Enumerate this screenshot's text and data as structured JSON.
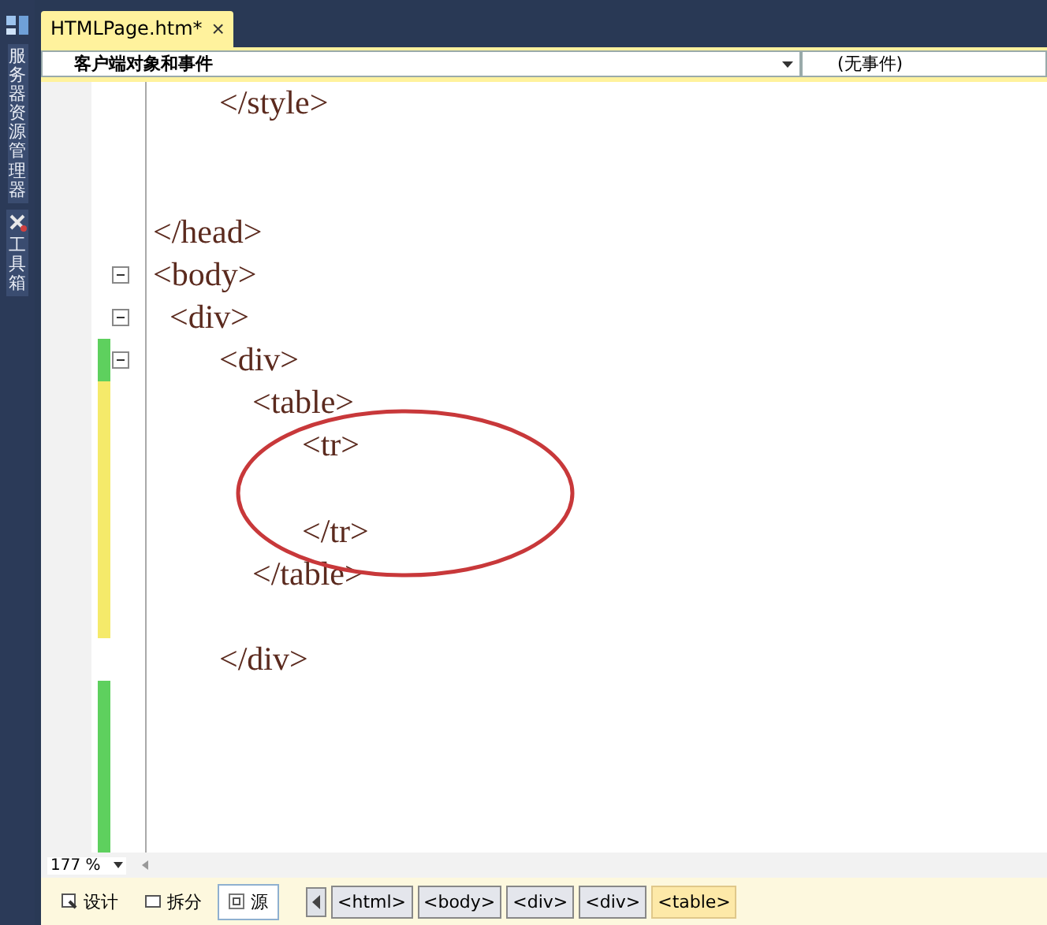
{
  "side_panel": {
    "tabs": [
      {
        "label": "服务器资源管理器"
      },
      {
        "label": "工具箱"
      }
    ]
  },
  "document_tab": {
    "title": "HTMLPage.htm*",
    "close": "×"
  },
  "navigation_bar": {
    "objects": "客户端对象和事件",
    "events": "(无事件)"
  },
  "editor": {
    "lines": [
      {
        "text": "        </style>"
      },
      {
        "kind": "blank"
      },
      {
        "kind": "blank"
      },
      {
        "text": "</head>"
      },
      {
        "text": "<body>",
        "fold": true
      },
      {
        "text": "  <div>",
        "fold": true
      },
      {
        "text": "        <div>",
        "fold": true,
        "color": "#5ed05e"
      },
      {
        "text": "            <table>",
        "color": "#f5ea6a"
      },
      {
        "text": "                  <tr>",
        "color": "#f5ea6a"
      },
      {
        "color": "#f5ea6a"
      },
      {
        "text": "                  </tr>",
        "color": "#f5ea6a"
      },
      {
        "text": "            </table>",
        "color": "#f5ea6a"
      },
      {
        "color": "#f5ea6a"
      },
      {
        "text": "        </div>"
      },
      {
        "color": "#5ed05e"
      },
      {
        "color": "#5ed05e"
      },
      {
        "color": "#5ed05e"
      },
      {
        "color": "#5ed05e"
      }
    ],
    "annotation": {
      "kind": "ellipse"
    }
  },
  "zoom": {
    "value": "177 %"
  },
  "view_buttons": [
    {
      "label": "设计",
      "selected": false
    },
    {
      "label": "拆分",
      "selected": false
    },
    {
      "label": "源",
      "selected": true
    }
  ],
  "breadcrumbs": [
    {
      "label": "<html>",
      "selected": false
    },
    {
      "label": "<body>",
      "selected": false
    },
    {
      "label": "<div>",
      "selected": false
    },
    {
      "label": "<div>",
      "selected": false
    },
    {
      "label": "<table>",
      "selected": true
    }
  ]
}
